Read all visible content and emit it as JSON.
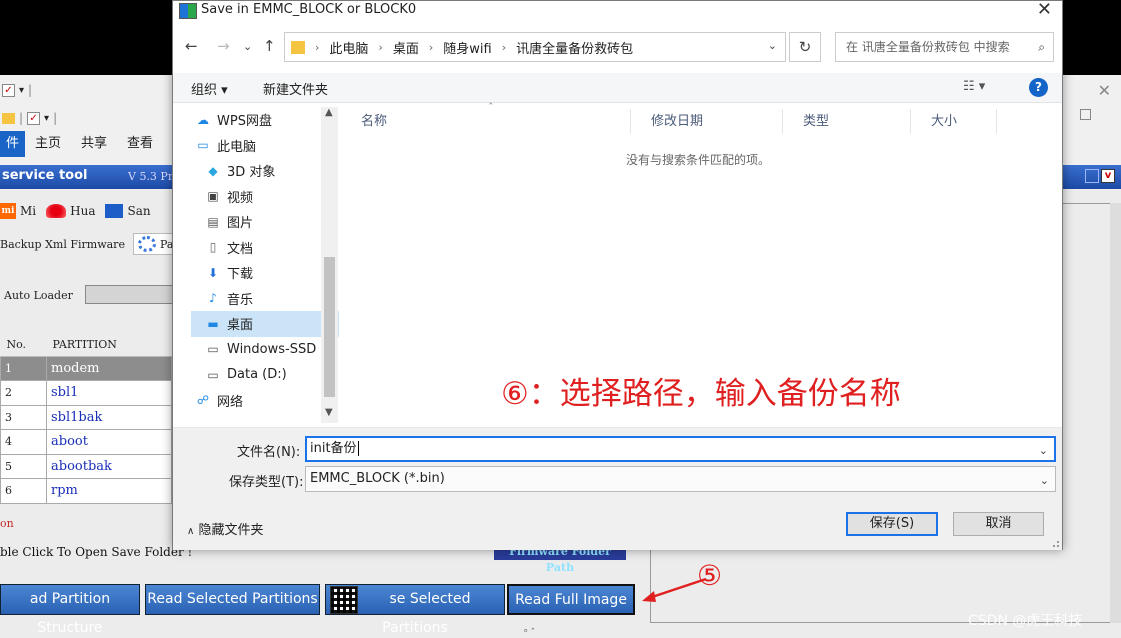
{
  "background_explorer": {
    "tabs": [
      "件",
      "主页",
      "共享",
      "查看"
    ]
  },
  "tool": {
    "title": "service tool",
    "version": "V 5.3 Pr",
    "brands": [
      "Mi",
      "Hua",
      "San"
    ],
    "sub_tabs": [
      "Backup Xml Firmware",
      "Par"
    ],
    "auto_loader_label": "Auto Loader",
    "table_headers": [
      "No.",
      "PARTITION"
    ],
    "partitions": [
      {
        "no": "1",
        "name": "modem",
        "selected": true
      },
      {
        "no": "2",
        "name": "sbl1"
      },
      {
        "no": "3",
        "name": "sbl1bak"
      },
      {
        "no": "4",
        "name": "aboot"
      },
      {
        "no": "5",
        "name": "abootbak"
      },
      {
        "no": "6",
        "name": "rpm"
      }
    ],
    "red_fragment": "on",
    "double_click_hint": "ble Click To Open Save Folder !",
    "firmware_folder_path": "Firmware Folder Path",
    "buttons": {
      "read_partition_structure": "ad Partition Structure",
      "read_selected_partitions": "Read Selected Partitions",
      "erase_selected_partitions": "se Selected Partitions",
      "read_full_image": "Read Full Image"
    }
  },
  "annotations": {
    "step5": "⑤",
    "step6": "⑥：选择路径，输入备份名称",
    "watermark": "CSDN @虎王科技"
  },
  "dialog": {
    "title": "Save in EMMC_BLOCK or BLOCK0",
    "breadcrumb": [
      "此电脑",
      "桌面",
      "随身wifi",
      "讯唐全量备份救砖包"
    ],
    "search_placeholder": "在 讯唐全量备份救砖包 中搜索",
    "toolbar": {
      "organize": "组织 ▾",
      "new_folder": "新建文件夹"
    },
    "nav_items": [
      {
        "label": "WPS网盘",
        "icon": "cloud-icon",
        "child": false
      },
      {
        "label": "此电脑",
        "icon": "computer-icon",
        "child": false
      },
      {
        "label": "3D 对象",
        "icon": "cube-icon",
        "child": true
      },
      {
        "label": "视频",
        "icon": "video-icon",
        "child": true
      },
      {
        "label": "图片",
        "icon": "picture-icon",
        "child": true
      },
      {
        "label": "文档",
        "icon": "document-icon",
        "child": true
      },
      {
        "label": "下载",
        "icon": "download-icon",
        "child": true
      },
      {
        "label": "音乐",
        "icon": "music-icon",
        "child": true
      },
      {
        "label": "桌面",
        "icon": "desktop-icon",
        "child": true,
        "selected": true
      },
      {
        "label": "Windows-SSD",
        "icon": "drive-icon",
        "child": true
      },
      {
        "label": "Data (D:)",
        "icon": "drive-icon",
        "child": true
      },
      {
        "label": "网络",
        "icon": "network-icon",
        "child": false
      }
    ],
    "columns": [
      "名称",
      "修改日期",
      "类型",
      "大小"
    ],
    "empty_message": "没有与搜索条件匹配的项。",
    "filename_label": "文件名(N):",
    "filename_value": "init备份",
    "filetype_label": "保存类型(T):",
    "filetype_value": "EMMC_BLOCK  (*.bin)",
    "hide_folders": "隐藏文件夹",
    "save_button": "保存(S)",
    "cancel_button": "取消"
  }
}
